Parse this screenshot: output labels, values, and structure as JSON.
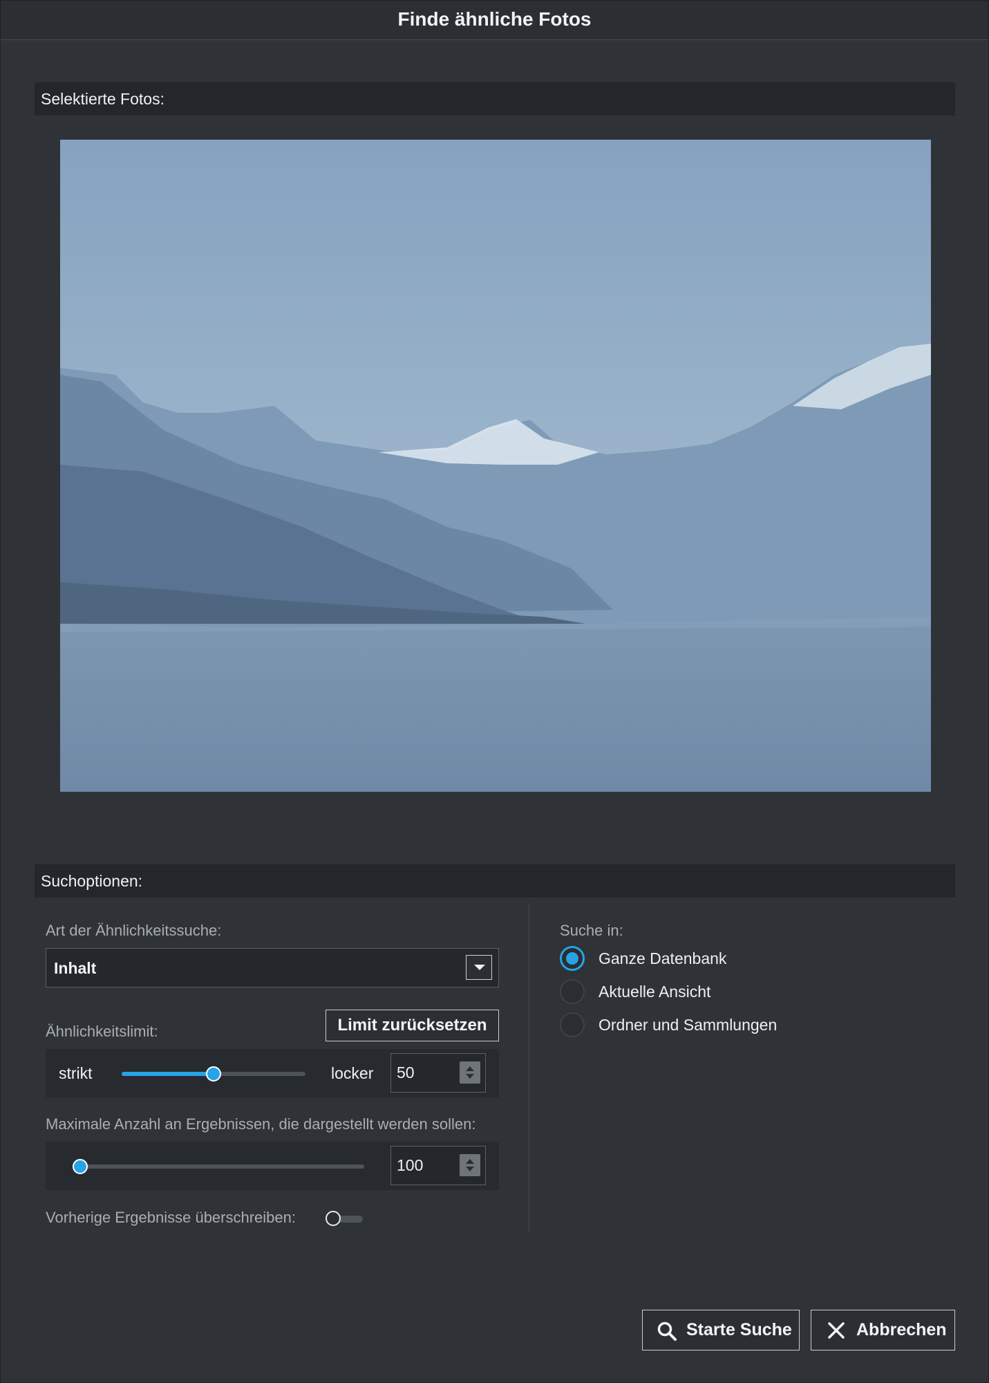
{
  "window": {
    "title": "Finde ähnliche Fotos"
  },
  "photos_section": {
    "header": "Selektierte Fotos:"
  },
  "options_section": {
    "header": "Suchoptionen:",
    "similarity_type": {
      "label": "Art der Ähnlichkeitssuche:",
      "value": "Inhalt"
    },
    "similarity_limit": {
      "label": "Ähnlichkeitslimit:",
      "reset_button": "Limit zurücksetzen",
      "left_label": "strikt",
      "right_label": "locker",
      "value": "50",
      "slider_fraction": 0.5
    },
    "max_results": {
      "label": "Maximale Anzahl an Ergebnissen, die dargestellt werden sollen:",
      "value": "100",
      "slider_fraction": 0.0
    },
    "overwrite": {
      "label": "Vorherige Ergebnisse überschreiben:",
      "enabled": false
    },
    "search_in": {
      "label": "Suche in:",
      "options": [
        {
          "label": "Ganze Datenbank",
          "checked": true
        },
        {
          "label": "Aktuelle Ansicht",
          "checked": false
        },
        {
          "label": "Ordner und Sammlungen",
          "checked": false
        }
      ]
    }
  },
  "actions": {
    "search": "Starte Suche",
    "cancel": "Abbrechen"
  },
  "colors": {
    "accent": "#27a3e6",
    "background": "#2f3338",
    "header": "#23272b"
  }
}
